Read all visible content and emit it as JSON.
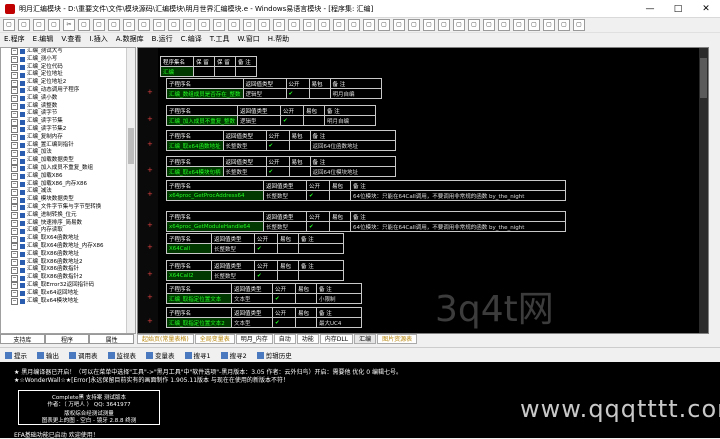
{
  "window": {
    "title": "明月汇编模块 - D:\\重要文件\\文件\\模块源码\\汇编模块\\明月世界汇编模块.e - Windows易语言模块 - [程序集: 汇编]",
    "minimize": "—",
    "maximize": "□",
    "close": "✕"
  },
  "toolbar": {
    "buttons": [
      "▢",
      "▢",
      "▢",
      "▢",
      "✂",
      "▢",
      "▢",
      "▢",
      "▢",
      "▢",
      "▢",
      "▢",
      "▢",
      "▢",
      "▢",
      "▢",
      "▢",
      "▢",
      "▢",
      "▢",
      "▢",
      "▢",
      "▢",
      "▢",
      "▢",
      "▢",
      "▢",
      "▢",
      "▢",
      "▢",
      "▢",
      "▢",
      "▢",
      "▢",
      "▢",
      "▢",
      "▢",
      "▢",
      "▢"
    ]
  },
  "menu": {
    "items": [
      "E.程序",
      "E.编辑",
      "V.查看",
      "I.插入",
      "A.数据库",
      "B.运行",
      "C.编译",
      "T.工具",
      "W.窗口",
      "H.帮助"
    ]
  },
  "tree": {
    "items": [
      "汇编_测试大写",
      "汇编_测小写",
      "汇编_定位代码",
      "汇编_定位地址",
      "汇编_定位地址2",
      "汇编_动态调用子程序",
      "汇编_读小数",
      "汇编_读整数",
      "汇编_读字节",
      "汇编_读字节集",
      "汇编_读字节集2",
      "汇编_复制内存",
      "汇编_置汇编到指针",
      "汇编_加法",
      "汇编_加载数据类型",
      "汇编_加入成员不重复_数组",
      "汇编_加载X86",
      "汇编_加载X86_内存X86",
      "汇编_减法",
      "汇编_模块数据类型",
      "汇编_文件字节集与字节型转换",
      "汇编_进制转换_位元",
      "汇编_快速排序_简易数",
      "汇编_内存读取",
      "汇编_取X64函数地址",
      "汇编_取X64函数地址_内存X86",
      "汇编_取X86函数地址",
      "汇编_取X86函数地址2",
      "汇编_取X86函数指针",
      "汇编_取X86函数指针2",
      "汇编_取Error32返回指针码",
      "汇编_取x64返回地址",
      "汇编_取x64模块地址"
    ]
  },
  "left_tabs": [
    "支持库",
    "程序",
    "属性"
  ],
  "editor": {
    "blocks": [
      {
        "headers": [
          "程序集名",
          "保 留",
          "保 留",
          "备 注"
        ],
        "values": [
          "汇编",
          "",
          "",
          ""
        ]
      },
      {
        "headers": [
          "子程序名",
          "返回值类型",
          "公开",
          "易包",
          "备 注"
        ],
        "values": [
          "汇编_数组成员是否存在_整数",
          "逻辑型",
          "✔",
          "",
          "明月自编"
        ]
      },
      {
        "headers": [
          "子程序名",
          "返回值类型",
          "公开",
          "易包",
          "备 注"
        ],
        "values": [
          "汇编_加入成员不重复_整数",
          "逻辑型",
          "✔",
          "",
          "明月自编"
        ]
      },
      {
        "headers": [
          "子程序名",
          "返回值类型",
          "公开",
          "易包",
          "备 注"
        ],
        "values": [
          "汇编_取x64函数地址",
          "长整数型",
          "✔",
          "",
          "返回64位函数地址"
        ]
      },
      {
        "headers": [
          "子程序名",
          "返回值类型",
          "公开",
          "易包",
          "备 注"
        ],
        "values": [
          "汇编_取x64模块句柄",
          "长整数型",
          "✔",
          "",
          "返回64位模块地址"
        ]
      },
      {
        "headers": [
          "子程序名",
          "返回值类型",
          "公开",
          "易包",
          "备 注"
        ],
        "values": [
          "x64proc_GetProcAddress64",
          "长整数型",
          "✔",
          "",
          "64位模块：只能在64Call调用，不要调用非常规的函数 by_the_night"
        ]
      },
      {
        "headers": [
          "子程序名",
          "返回值类型",
          "公开",
          "易包",
          "备 注"
        ],
        "values": [
          "x64proc_GetModuleHandle64",
          "长整数型",
          "✔",
          "",
          "64位模块：只能在64Call调用，不要调用非常规的函数 by_the_night"
        ]
      },
      {
        "headers": [
          "子程序名",
          "返回值类型",
          "公开",
          "易包",
          "备 注"
        ],
        "values": [
          "X64Call",
          "长整数型",
          "✔",
          "",
          ""
        ]
      },
      {
        "headers": [
          "子程序名",
          "返回值类型",
          "公开",
          "易包",
          "备 注"
        ],
        "values": [
          "X64Call2",
          "长整数型",
          "✔",
          "",
          ""
        ]
      },
      {
        "headers": [
          "子程序名",
          "返回值类型",
          "公开",
          "易包",
          "备 注"
        ],
        "values": [
          "汇编_取指定位置文本",
          "文本型",
          "✔",
          "",
          "小限制"
        ]
      },
      {
        "headers": [
          "子程序名",
          "返回值类型",
          "公开",
          "易包",
          "备 注"
        ],
        "values": [
          "汇编_取指定位置文本2",
          "文本型",
          "✔",
          "",
          "最大UC4"
        ]
      }
    ]
  },
  "code_tabs": [
    {
      "label": "起始页(常量表格)",
      "highlight": true
    },
    {
      "label": "全局变量表",
      "highlight": true
    },
    {
      "label": "明月_内存",
      "highlight": false
    },
    {
      "label": "自动",
      "highlight": false
    },
    {
      "label": "功能",
      "highlight": false
    },
    {
      "label": "内存DLL",
      "highlight": false
    },
    {
      "label": "汇编",
      "highlight": false
    },
    {
      "label": "图片资源表",
      "highlight": true
    }
  ],
  "output_tabs": [
    "提示",
    "输出",
    "调用表",
    "监视表",
    "变量表",
    "搜寻1",
    "搜寻2",
    "剪辑历史"
  ],
  "output": {
    "line1": "★ 黑月编译器已开启！（可以在菜单中选择\"工具\"->\"黑月工具\"中\"软件选项\"-黑月版本：3.05  作者：云外归鸟）开启：需要他 优化 0 编辑七号。",
    "line2": "★☆WonderWall☆★[Error]永远保留目前实有的画面制作 1.905.11版本 与现在在使用的新版本不符！",
    "box_title": "Complete黑 支持案      测试版本",
    "box_author": "作者：（ 万吧人 ）      QQ: 3641977",
    "box_line3": "版权综合经测试测量",
    "box_line4": "图表更上的图 - 空白 - 镜牙 2.8.8 终测",
    "last": "EFA基础功能已启动 欢迎使用！"
  },
  "watermark": {
    "center": "3q4t网",
    "bottom": "www.qqqtttt.com"
  }
}
